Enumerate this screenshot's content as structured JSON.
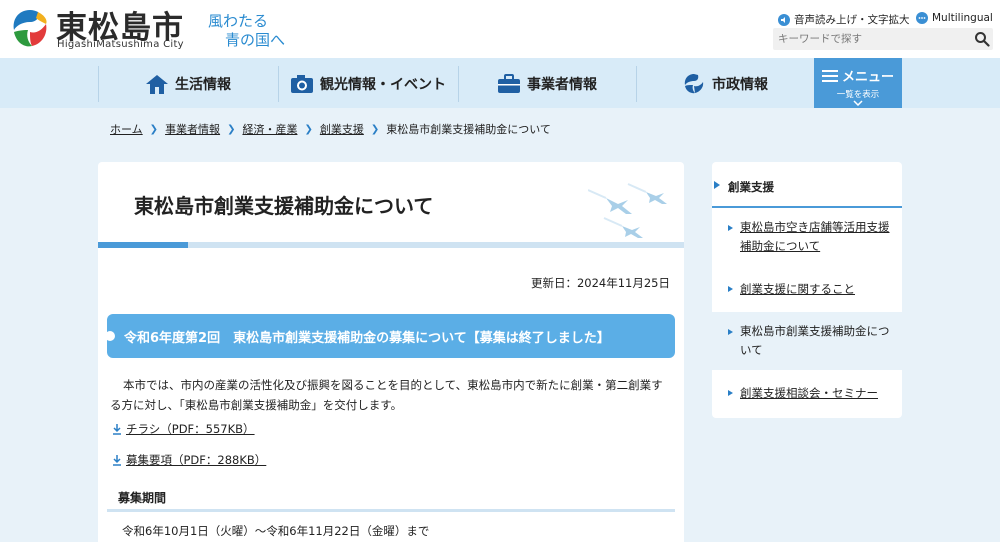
{
  "header": {
    "logo_title": "東松島市",
    "logo_sub": "HigashiMatsushima City",
    "catch_line1": "風わたる",
    "catch_line2": "青の国へ",
    "voice_label": "音声読み上げ・文字拡大",
    "lang_label": "Multilingual",
    "search_placeholder": "キーワードで探す"
  },
  "nav": {
    "items": [
      {
        "label": "生活情報",
        "icon": "house-icon"
      },
      {
        "label": "観光情報・イベント",
        "icon": "camera-icon"
      },
      {
        "label": "事業者情報",
        "icon": "briefcase-icon"
      },
      {
        "label": "市政情報",
        "icon": "city-emblem-icon"
      }
    ],
    "menu_label": "メニュー",
    "menu_sub": "一覧を表示"
  },
  "breadcrumb": {
    "items": [
      "ホーム",
      "事業者情報",
      "経済・産業",
      "創業支援"
    ],
    "current": "東松島市創業支援補助金について"
  },
  "main": {
    "title": "東松島市創業支援補助金について",
    "updated": "更新日：2024年11月25日",
    "section_heading": "令和6年度第2回　東松島市創業支援補助金の募集について【募集は終了しました】",
    "intro": "本市では、市内の産業の活性化及び振興を図ることを目的として、東松島市内で新たに創業・第二創業する方に対し、「東松島市創業支援補助金」を交付します。",
    "downloads": [
      {
        "label": "チラシ（PDF：557KB）"
      },
      {
        "label": "募集要項（PDF：288KB）"
      }
    ],
    "period_heading": "募集期間",
    "period_text": "令和6年10月1日（火曜）～令和6年11月22日（金曜）まで"
  },
  "side": {
    "heading": "創業支援",
    "items": [
      {
        "label": "東松島市空き店舗等活用支援補助金について",
        "active": false
      },
      {
        "label": "創業支援に関すること",
        "active": false
      },
      {
        "label": "東松島市創業支援補助金について",
        "active": true
      },
      {
        "label": "創業支援相談会・セミナー",
        "active": false
      }
    ]
  },
  "colors": {
    "accent": "#4a9ad8",
    "nav_bg": "#d8ebf8",
    "page_bg": "#e8f2f9",
    "section_head": "#5baee6"
  }
}
